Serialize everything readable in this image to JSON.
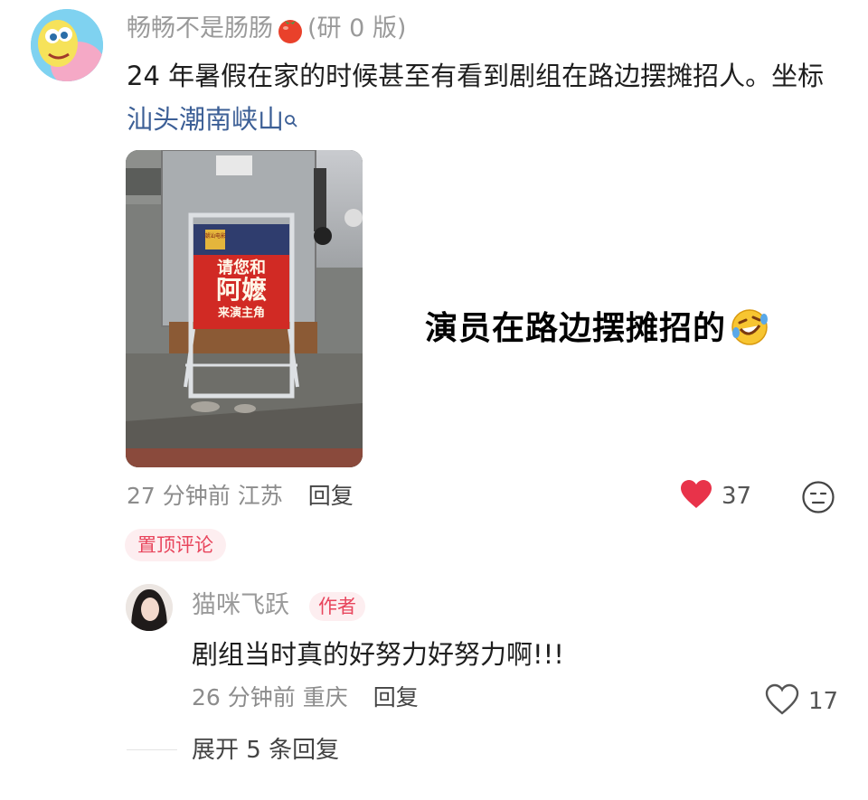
{
  "comment": {
    "username": "畅畅不是肠肠",
    "username_suffix": "(研 0 版)",
    "text": "24 年暑假在家的时候甚至有看到剧组在路边摆摊招人。坐标 ",
    "location_link": "汕头潮南峡山",
    "image": {
      "sign_tag": "潮汕电影",
      "sign_line1": "请您和",
      "sign_line2": "阿嬷",
      "sign_line3": "来演主角"
    },
    "overlay_caption": "演员在路边摆摊招的",
    "time": "27 分钟前",
    "location": "江苏",
    "reply_label": "回复",
    "like_count": "37",
    "liked": true,
    "pinned_badge": "置顶评论"
  },
  "reply": {
    "username": "猫咪飞跃",
    "author_badge": "作者",
    "text": "剧组当时真的好努力好努力啊!!!",
    "time": "26 分钟前",
    "location": "重庆",
    "reply_label": "回复",
    "like_count": "17",
    "liked": false
  },
  "expand_replies": "展开 5 条回复",
  "colors": {
    "like_red": "#e8334a",
    "badge_pink_bg": "#fdeef0",
    "badge_pink_text": "#e8455c",
    "link_blue": "#3c5f96",
    "meta_gray": "#8c8c8c"
  }
}
